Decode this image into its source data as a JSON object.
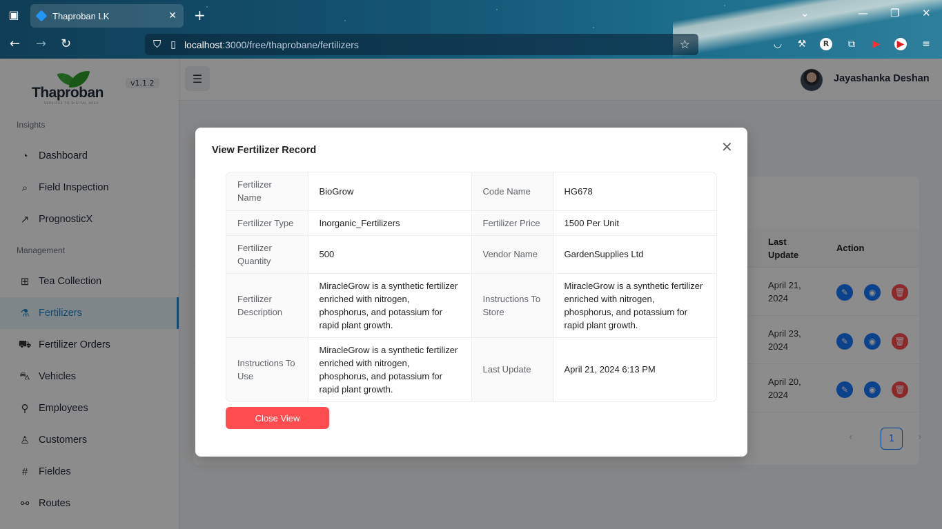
{
  "browser": {
    "tab_title": "Thaproban LK",
    "url_host": "localhost",
    "url_path": ":3000/free/thaprobane/fertilizers"
  },
  "sidebar": {
    "logo_text": "Thaproban",
    "logo_tagline": "SERVICES TO DIGITAL AREA",
    "version": "v1.1.2",
    "sections": [
      {
        "label": "Insights"
      },
      {
        "label": "Management"
      }
    ],
    "items": [
      {
        "label": "Dashboard",
        "icon": "gauge-icon"
      },
      {
        "label": "Field Inspection",
        "icon": "search-icon"
      },
      {
        "label": "PrognosticX",
        "icon": "trend-icon"
      },
      {
        "label": "Tea Collection",
        "icon": "grid-icon"
      },
      {
        "label": "Fertilizers",
        "icon": "flask-icon",
        "active": true
      },
      {
        "label": "Fertilizer Orders",
        "icon": "cart-icon"
      },
      {
        "label": "Vehicles",
        "icon": "car-icon"
      },
      {
        "label": "Employees",
        "icon": "user-search-icon"
      },
      {
        "label": "Customers",
        "icon": "user-icon"
      },
      {
        "label": "Fieldes",
        "icon": "hash-icon"
      },
      {
        "label": "Routes",
        "icon": "route-icon"
      }
    ]
  },
  "header": {
    "user_name": "Jayashanka Deshan"
  },
  "table": {
    "headers": {
      "last_update": "Last Update",
      "action": "Action"
    },
    "rows": [
      {
        "last_update": "April 21, 2024"
      },
      {
        "last_update": "April 23, 2024"
      },
      {
        "last_update": "April 20, 2024"
      }
    ],
    "current_page": "1"
  },
  "modal": {
    "title": "View Fertilizer Record",
    "close_button": "Close View",
    "fields": {
      "fertilizer_name_label": "Fertilizer Name",
      "fertilizer_name": "BioGrow",
      "code_name_label": "Code Name",
      "code_name": "HG678",
      "fertilizer_type_label": "Fertilizer Type",
      "fertilizer_type": "Inorganic_Fertilizers",
      "fertilizer_price_label": "Fertilizer Price",
      "fertilizer_price": "1500 Per Unit",
      "fertilizer_quantity_label": "Fertilizer Quantity",
      "fertilizer_quantity": "500",
      "vendor_name_label": "Vendor Name",
      "vendor_name": "GardenSupplies Ltd",
      "fertilizer_description_label": "Fertilizer Description",
      "fertilizer_description": "MiracleGrow is a synthetic fertilizer enriched with nitrogen, phosphorus, and potassium for rapid plant growth.",
      "instructions_to_store_label": "Instructions To Store",
      "instructions_to_store": "MiracleGrow is a synthetic fertilizer enriched with nitrogen, phosphorus, and potassium for rapid plant growth.",
      "instructions_to_use_label": "Instructions To Use",
      "instructions_to_use": "MiracleGrow is a synthetic fertilizer enriched with nitrogen, phosphorus, and potassium for rapid plant growth.",
      "last_update_label": "Last Update",
      "last_update": "April 21, 2024 6:13 PM"
    }
  }
}
